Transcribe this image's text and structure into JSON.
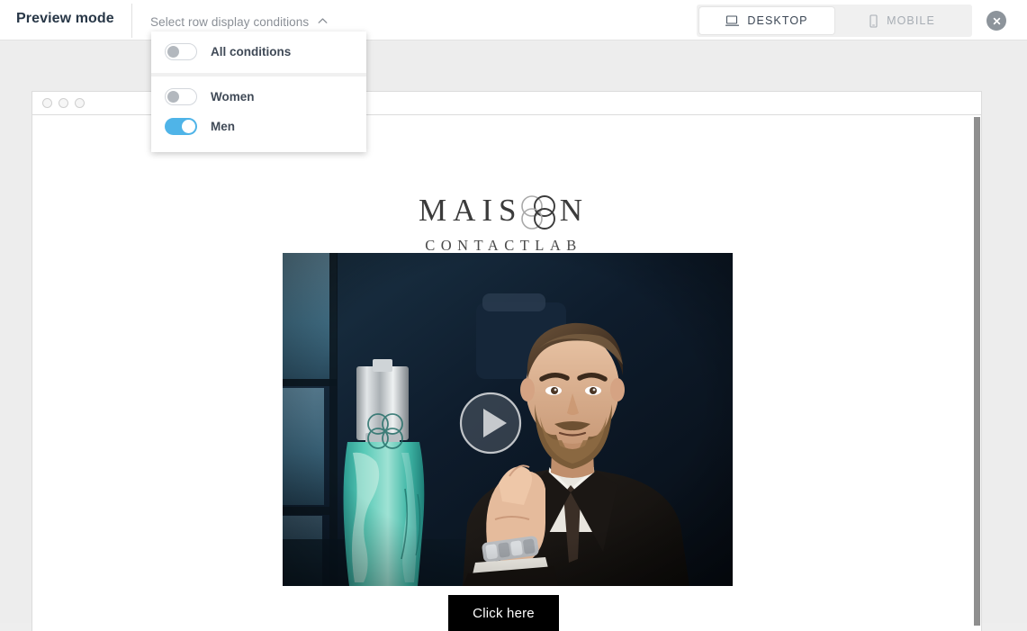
{
  "header": {
    "title": "Preview mode",
    "condition_select": {
      "label": "Select row display conditions",
      "chevron_icon": "chevron-up-icon",
      "expanded": true
    },
    "device_switch": {
      "desktop": {
        "label": "DESKTOP",
        "icon": "desktop-monitor-icon",
        "active": true
      },
      "mobile": {
        "label": "MOBILE",
        "icon": "mobile-phone-icon",
        "active": false
      }
    },
    "close": {
      "icon": "close-circle-icon",
      "label": ""
    }
  },
  "dropdown": {
    "top_section": [
      {
        "label": "All conditions",
        "enabled": false
      }
    ],
    "bottom_section": [
      {
        "label": "Women",
        "enabled": false
      },
      {
        "label": "Men",
        "enabled": true
      }
    ]
  },
  "browser": {
    "dots": [
      "dot-1",
      "dot-2",
      "dot-3"
    ],
    "scrollbar": {
      "name": "vertical-scrollbar"
    }
  },
  "email": {
    "logo": {
      "brand_before": "MAIS",
      "brand_after": "N",
      "flower_icon": "four-circle-flower-icon",
      "subtitle": "CONTACTLAB"
    },
    "hero": {
      "alt": "bearded-man-in-suit-with-teal-perfume-bottle",
      "play_icon": "play-button-icon"
    },
    "cta": {
      "label": "Click here"
    }
  },
  "colors": {
    "accent_blue": "#4fb4e8",
    "stage_gray": "#ededed",
    "title_navy": "#283747",
    "muted_gray": "#8a8f96",
    "cta_black": "#000000",
    "perfume_teal": "#3cb9a8"
  }
}
